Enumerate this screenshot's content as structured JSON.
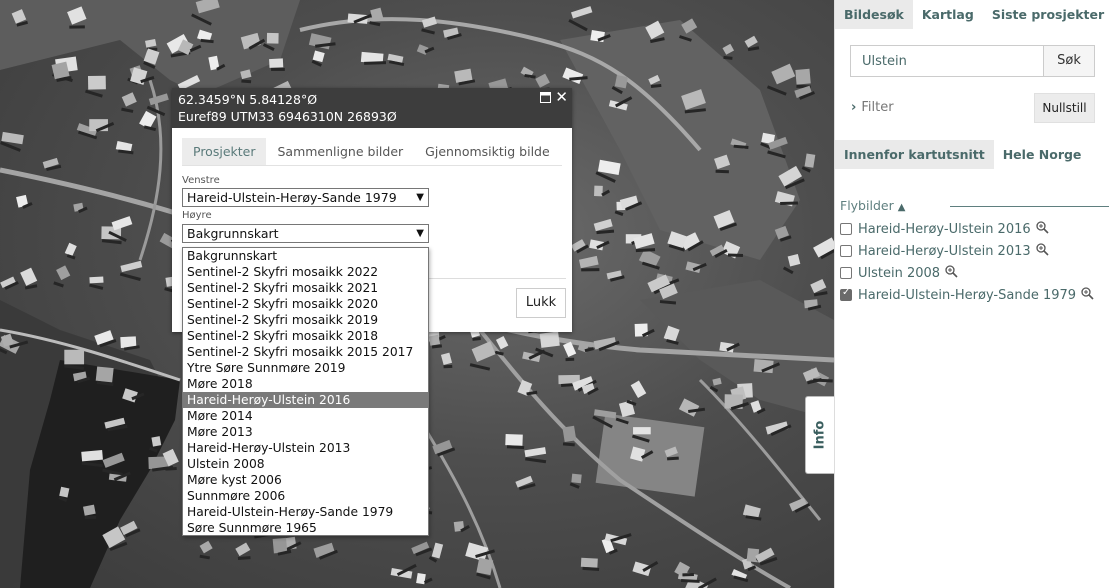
{
  "popup": {
    "coords_line1": "62.3459°N 5.84128°Ø",
    "coords_line2": "Euref89 UTM33 6946310N 26893Ø",
    "maximize_icon": "window-maximize-icon",
    "close_icon": "close-icon",
    "tabs": [
      {
        "label": "Prosjekter"
      },
      {
        "label": "Sammenligne bilder"
      },
      {
        "label": "Gjennomsiktig bilde"
      }
    ],
    "left_label": "Venstre",
    "left_value": "Hareid-Ulstein-Herøy-Sande 1979",
    "right_label": "Høyre",
    "right_value": "Bakgrunnskart",
    "close_button": "Lukk"
  },
  "dropdown": {
    "options": [
      "Bakgrunnskart",
      "Sentinel-2 Skyfri mosaikk 2022",
      "Sentinel-2 Skyfri mosaikk 2021",
      "Sentinel-2 Skyfri mosaikk 2020",
      "Sentinel-2 Skyfri mosaikk 2019",
      "Sentinel-2 Skyfri mosaikk 2018",
      "Sentinel-2 Skyfri mosaikk 2015 2017",
      "Ytre Søre Sunnmøre 2019",
      "Møre 2018",
      "Hareid-Herøy-Ulstein 2016",
      "Møre 2014",
      "Møre 2013",
      "Hareid-Herøy-Ulstein 2013",
      "Ulstein 2008",
      "Møre kyst 2006",
      "Sunnmøre 2006",
      "Hareid-Ulstein-Herøy-Sande 1979",
      "Søre Sunnmøre 1965"
    ],
    "highlighted": "Hareid-Herøy-Ulstein 2016"
  },
  "info_tab": "Info",
  "sidebar": {
    "top_tabs": [
      {
        "label": "Bildesøk"
      },
      {
        "label": "Kartlag"
      },
      {
        "label": "Siste prosjekter"
      }
    ],
    "search": {
      "value": "Ulstein",
      "button": "Søk"
    },
    "filter_label": "Filter",
    "reset_button": "Nullstill",
    "scope_tabs": [
      {
        "label": "Innenfor kartutsnitt"
      },
      {
        "label": "Hele Norge"
      }
    ],
    "section_title": "Flybilder",
    "projects": [
      {
        "label": "Hareid-Herøy-Ulstein 2016",
        "checked": false
      },
      {
        "label": "Hareid-Herøy-Ulstein 2013",
        "checked": false
      },
      {
        "label": "Ulstein 2008",
        "checked": false
      },
      {
        "label": "Hareid-Ulstein-Herøy-Sande 1979",
        "checked": true
      }
    ]
  },
  "colors": {
    "accent": "#4a6a6a",
    "popup_header": "#3d3d3d",
    "selection": "#7a7a7a"
  }
}
